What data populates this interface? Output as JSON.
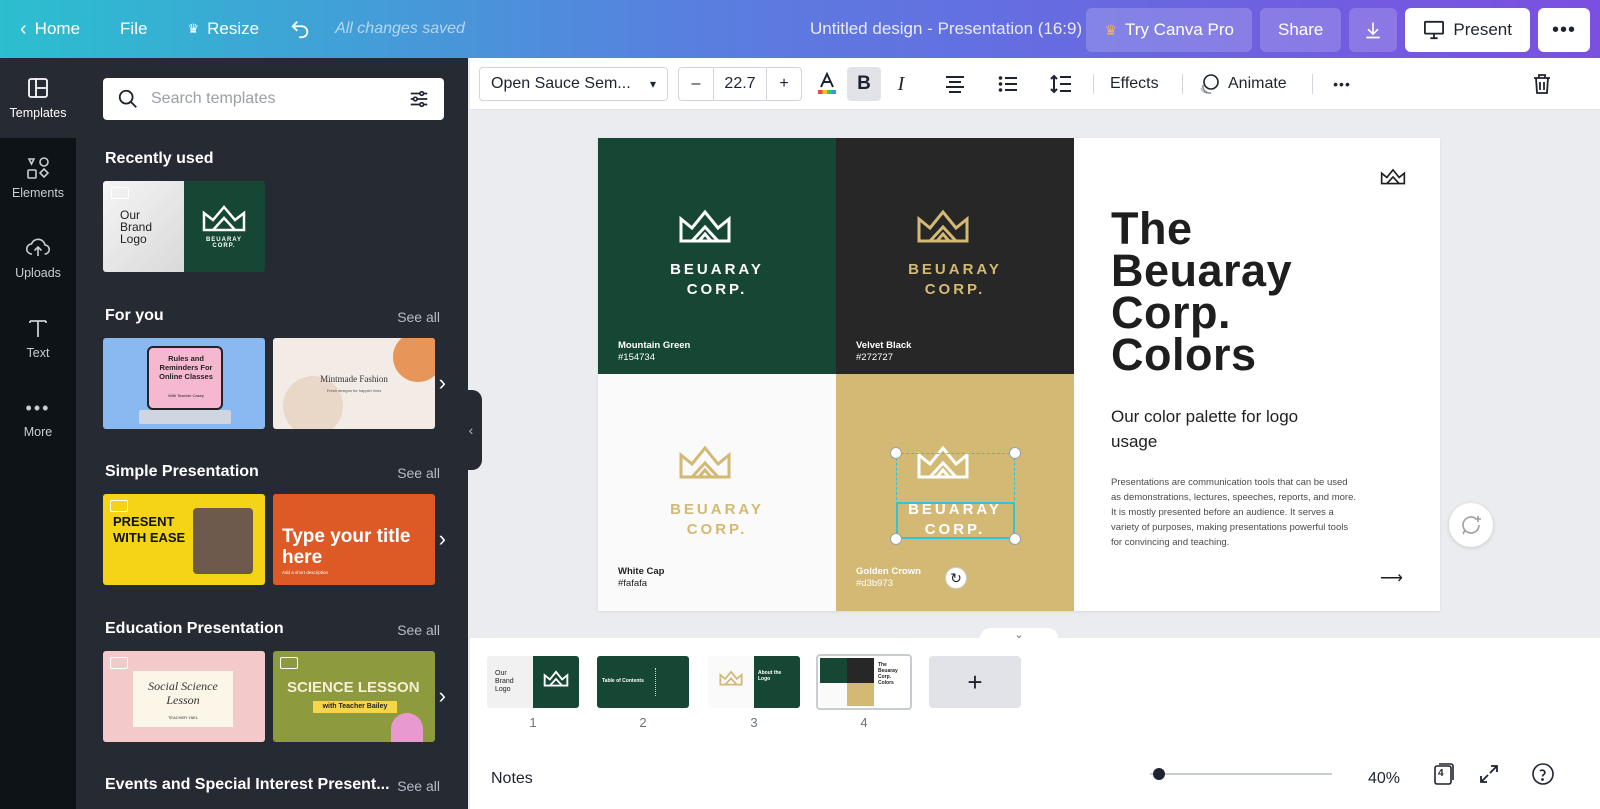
{
  "topbar": {
    "home": "Home",
    "file": "File",
    "resize": "Resize",
    "saved": "All changes saved",
    "title": "Untitled design - Presentation (16:9)",
    "try_pro": "Try Canva Pro",
    "share": "Share",
    "present": "Present"
  },
  "rail": {
    "items": [
      {
        "label": "Templates",
        "icon": "layout-icon"
      },
      {
        "label": "Elements",
        "icon": "shapes-icon"
      },
      {
        "label": "Uploads",
        "icon": "cloud-upload-icon"
      },
      {
        "label": "Text",
        "icon": "text-icon"
      },
      {
        "label": "More",
        "icon": "dots-icon"
      }
    ]
  },
  "panel": {
    "search_placeholder": "Search templates",
    "sections": [
      {
        "title": "Recently used",
        "see_all": ""
      },
      {
        "title": "For you",
        "see_all": "See all"
      },
      {
        "title": "Simple Presentation",
        "see_all": "See all"
      },
      {
        "title": "Education Presentation",
        "see_all": "See all"
      },
      {
        "title": "Events and Special Interest Present...",
        "see_all": "See all"
      }
    ],
    "recent_thumb": {
      "text": "Our Brand Logo",
      "logo": "BEUARAY CORP."
    },
    "for_you": [
      {
        "title": "Rules and Reminders For Online Classes",
        "sub": "With Teacher Casey"
      },
      {
        "title": "Mintmade Fashion",
        "sub": "Fresh designs for happier lives"
      }
    ],
    "simple": [
      {
        "title": "PRESENT WITH EASE"
      },
      {
        "title": "Type your title here",
        "sub": "Add a short description"
      }
    ],
    "education": [
      {
        "title": "Social Science Lesson",
        "sub": "TEACHER YAEL"
      },
      {
        "title": "SCIENCE LESSON",
        "sub": "with Teacher Bailey"
      }
    ]
  },
  "toolbar": {
    "font": "Open Sauce Sem...",
    "minus": "–",
    "size": "22.7",
    "plus": "+",
    "effects": "Effects",
    "animate": "Animate"
  },
  "slide": {
    "title_lines": [
      "The",
      "Beuaray",
      "Corp.",
      "Colors"
    ],
    "subtitle": "Our color palette for logo usage",
    "body": "Presentations are communication tools that can be used as demonstrations, lectures, speeches, reports, and more. It is mostly presented before an audience. It serves a variety of purposes, making presentations powerful tools for convincing and teaching.",
    "logo_line1": "BEUARAY",
    "logo_line2": "CORP.",
    "colors": [
      {
        "name": "Mountain Green",
        "hex": "#154734",
        "bg": "#154734",
        "fg": "#ffffff"
      },
      {
        "name": "Velvet Black",
        "hex": "#272727",
        "bg": "#272727",
        "fg": "#d3b973"
      },
      {
        "name": "White Cap",
        "hex": "#fafafa",
        "bg": "#fafafa",
        "fg": "#d3b973"
      },
      {
        "name": "Golden Crown",
        "hex": "#d3b973",
        "bg": "#d3b973",
        "fg": "#ffffff"
      }
    ]
  },
  "pages": {
    "numbers": [
      "1",
      "2",
      "3",
      "4"
    ],
    "page2_title": "Table of Contents",
    "page3_title": "About the Logo"
  },
  "footer": {
    "notes": "Notes",
    "zoom": "40%",
    "page_count": "4"
  }
}
